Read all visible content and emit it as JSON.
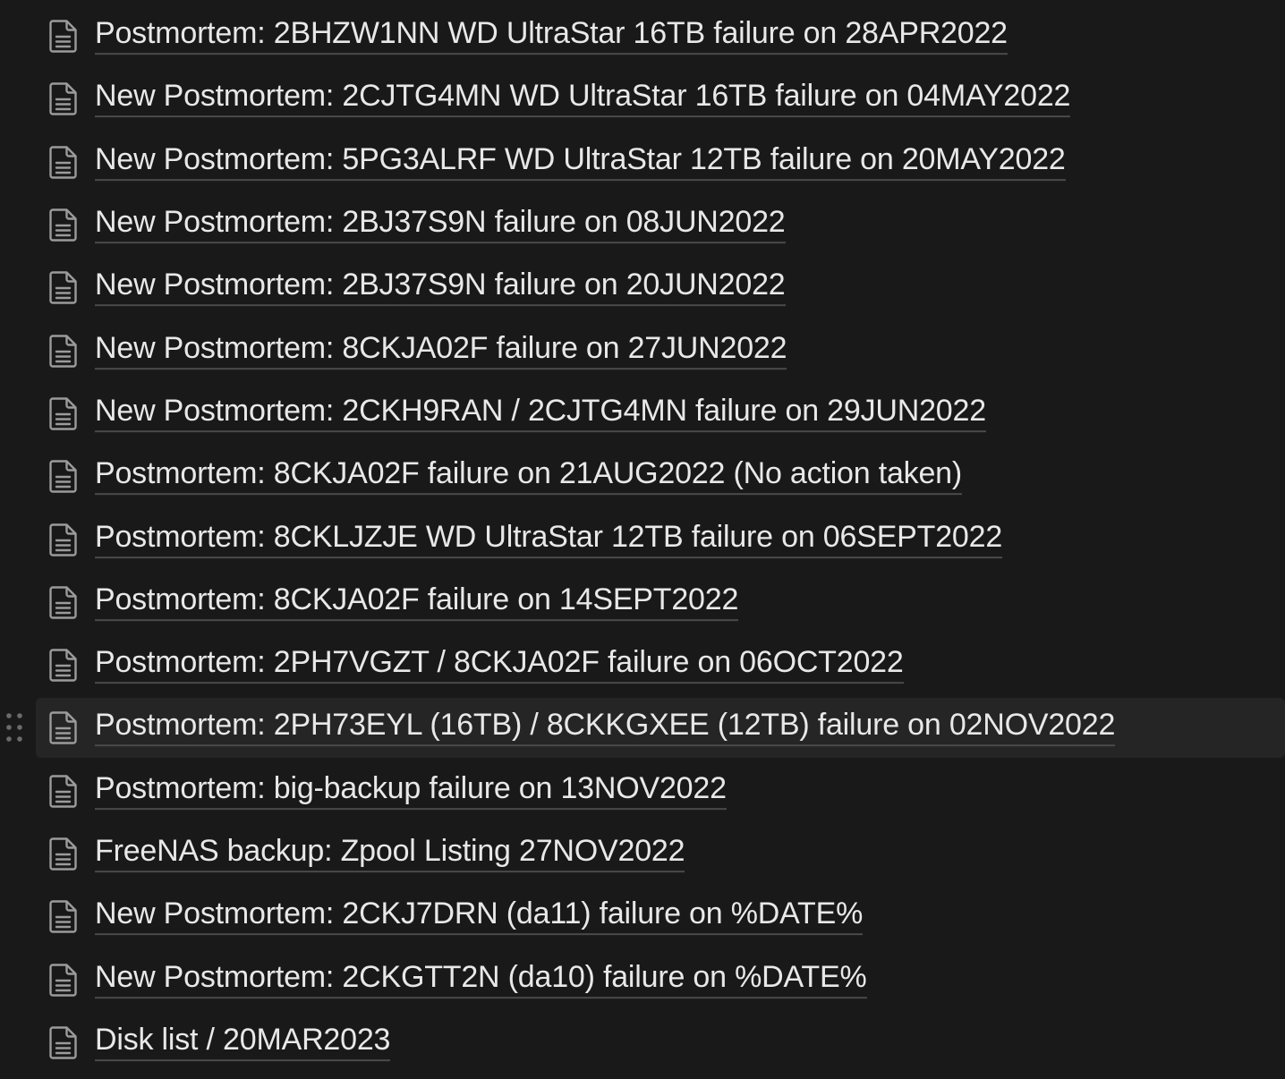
{
  "pages": [
    {
      "title": "Postmortem: 2BHZW1NN WD UltraStar 16TB failure on 28APR2022"
    },
    {
      "title": "New Postmortem: 2CJTG4MN WD UltraStar 16TB failure on 04MAY2022"
    },
    {
      "title": "New Postmortem: 5PG3ALRF WD UltraStar 12TB failure on 20MAY2022"
    },
    {
      "title": "New Postmortem: 2BJ37S9N failure on 08JUN2022"
    },
    {
      "title": "New Postmortem: 2BJ37S9N failure on 20JUN2022"
    },
    {
      "title": "New Postmortem: 8CKJA02F failure on 27JUN2022"
    },
    {
      "title": "New Postmortem: 2CKH9RAN / 2CJTG4MN failure on 29JUN2022"
    },
    {
      "title": "Postmortem: 8CKJA02F failure on 21AUG2022 (No action taken)"
    },
    {
      "title": "Postmortem: 8CKLJZJE WD UltraStar 12TB failure on 06SEPT2022"
    },
    {
      "title": "Postmortem: 8CKJA02F failure on 14SEPT2022"
    },
    {
      "title": "Postmortem: 2PH7VGZT / 8CKJA02F failure on 06OCT2022"
    },
    {
      "title": "Postmortem: 2PH73EYL (16TB) / 8CKKGXEE (12TB) failure on 02NOV2022",
      "hovered": true
    },
    {
      "title": "Postmortem: big-backup failure on 13NOV2022"
    },
    {
      "title": "FreeNAS backup: Zpool Listing 27NOV2022"
    },
    {
      "title": "New Postmortem: 2CKJ7DRN (da11) failure on %DATE%"
    },
    {
      "title": "New Postmortem: 2CKGTT2N (da10) failure on %DATE%"
    },
    {
      "title": "Disk list / 20MAR2023"
    }
  ],
  "icons": {
    "page": "document-icon",
    "drag": "drag-handle-icon"
  },
  "colors": {
    "background": "#191919",
    "hover_background": "#252525",
    "text": "#e8e8e8",
    "underline": "#4a4a4a",
    "icon": "#9b9b9b"
  }
}
